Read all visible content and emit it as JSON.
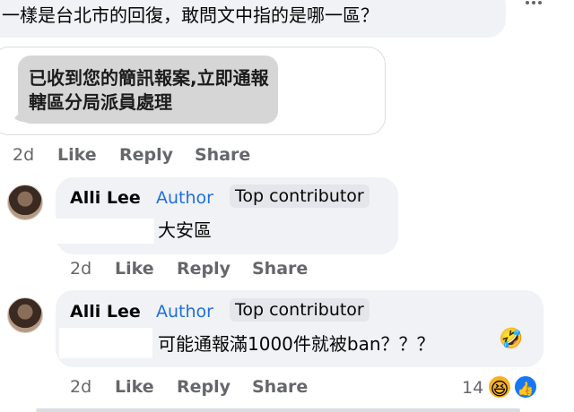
{
  "top_comment": {
    "text": "一樣是台北市的回復，敢問文中指的是哪一區？"
  },
  "image_comment": {
    "sms_text": "已收到您的簡訊報案,立即通報轄區分局派員處理",
    "time": "2d",
    "like": "Like",
    "reply": "Reply",
    "share": "Share"
  },
  "reply1": {
    "name": "Alli Lee",
    "author_label": "Author",
    "badge": "Top contributor",
    "text": "大安區",
    "time": "2d",
    "like": "Like",
    "reply": "Reply",
    "share": "Share"
  },
  "reply2": {
    "name": "Alli Lee",
    "author_label": "Author",
    "badge": "Top contributor",
    "text": "可能通報滿1000件就被ban？？？",
    "emoji": "🤣",
    "time": "2d",
    "like": "Like",
    "reply": "Reply",
    "share": "Share",
    "reaction_count": "14",
    "reactions": [
      "haha",
      "like"
    ]
  },
  "colors": {
    "bubble": "#f0f2f5",
    "author": "#216fdb",
    "meta": "#65676b",
    "like_blue": "#1877f2"
  }
}
